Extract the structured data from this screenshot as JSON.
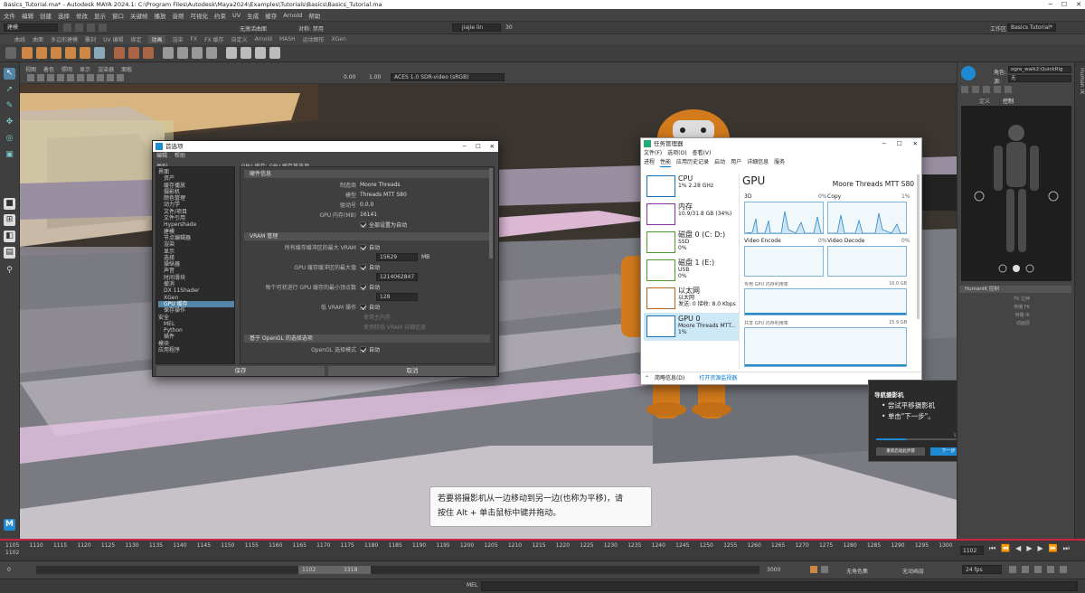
{
  "app": {
    "title": "Basics_Tutorial.ma* - Autodesk MAYA 2024.1: C:\\Program Files\\Autodesk\\Maya2024\\Examples\\Tutorials\\Basics\\Basics_Tutorial.ma",
    "menu": [
      "文件",
      "编辑",
      "创建",
      "选择",
      "修改",
      "显示",
      "窗口",
      "动画",
      "播放",
      "音频",
      "可视化",
      "缓存",
      "Arnold",
      "帮助"
    ],
    "menu_left": [
      "文件",
      "编辑",
      "创建",
      "选择",
      "修改",
      "显示",
      "窗口",
      "关键帧",
      "播放",
      "音频",
      "可视化",
      "约束",
      "UV",
      "生成",
      "缓存",
      "Arnold",
      "帮助"
    ],
    "mode": "建模",
    "no_live": "无激活曲面",
    "symmetry": "对称: 禁用",
    "user": "jiajie lin",
    "credits": "30",
    "workspace_label": "工作区:",
    "workspace": "Basics Tutorial*",
    "shelf_tabs": [
      "曲线",
      "曲面",
      "多边形建模",
      "雕刻",
      "UV 编辑",
      "绑定",
      "动画",
      "渲染",
      "FX",
      "FX 缓存",
      "自定义",
      "Arnold",
      "MASH",
      "运动图形",
      "XGen"
    ],
    "shelf_active": "动画"
  },
  "viewport": {
    "menu": [
      "视图",
      "着色",
      "照明",
      "显示",
      "渲染器",
      "面板"
    ],
    "exposure": "0.00",
    "gamma": "1.00",
    "colorspace": "ACES 1.0 SDR-video (sRGB)"
  },
  "right": {
    "char_label": "角色:",
    "char_value": "ogre_walk2:QuickRig",
    "src_label": "源:",
    "src_value": "无",
    "tabs": [
      "定义",
      "控制"
    ],
    "hik_label": "HumanIK 控制",
    "rows": [
      "FK 拉伸",
      "骨骼 FK",
      "骨骼 IK",
      "动画层"
    ],
    "side": "Human IK"
  },
  "prefs": {
    "title": "首选项",
    "menu": [
      "编辑",
      "帮助"
    ],
    "header": "GPU 缓存: GPU 缓存首选项",
    "cat_label": "类别",
    "categories": [
      "界面",
      "资产",
      "缓存播放",
      "摄影机",
      "颜色管理",
      "动力学",
      "文件/项目",
      "文件引用",
      "Hypershade",
      "建模",
      "节点编辑器",
      "渲染",
      "显示",
      "选择",
      "操纵器",
      "声音",
      "时间滑块",
      "撤消",
      "DX 11Shader",
      "XGen",
      "GPU 缓存",
      "保存操作",
      "安全",
      "MEL",
      "Python",
      "插件",
      "模块",
      "应用程序"
    ],
    "selected": "GPU 缓存",
    "hw_section": "硬件信息",
    "vendor_label": "制造商",
    "vendor": "Moore Threads",
    "model_label": "模型",
    "model": "Threads MTT S80",
    "driver_label": "驱动号",
    "driver": "0.0.0",
    "mem_label": "GPU 内存(MB)",
    "mem": "16141",
    "override": "全部设置为自动",
    "vram_section": "VRAM 管理",
    "vram1": "所有缓存缓冲区的最大 VRAM",
    "auto": "自动",
    "vram1_val": "15629",
    "mb": "MB",
    "vram2": "GPU 缓存缓冲区的最大值",
    "vram2_val": "1214062847",
    "vram3": "每个可状进行 GPU 缓存的最小顶点数",
    "vram3_val": "128",
    "low_vram": "低 VRAM 操作",
    "sub1": "使用主内存",
    "sub2": "使用较低 VRAM 详细信息",
    "opengl_section": "基于 OpenGL 的选择选项",
    "opengl_label": "OpenGL 选择模式",
    "save": "保存",
    "cancel": "取消"
  },
  "taskmgr": {
    "title": "任务管理器",
    "menu": [
      "文件(F)",
      "选项(O)",
      "查看(V)"
    ],
    "tabs": [
      "进程",
      "性能",
      "应用历史记录",
      "启动",
      "用户",
      "详细信息",
      "服务"
    ],
    "active_tab": "性能",
    "items": [
      {
        "name": "CPU",
        "l1": "1%  2.28 GHz",
        "l2": "",
        "color": "#1a73b8"
      },
      {
        "name": "内存",
        "l1": "10.9/31.8 GB (34%)",
        "l2": "",
        "color": "#8b2fa8"
      },
      {
        "name": "磁盘 0 (C: D:)",
        "l1": "SSD",
        "l2": "0%",
        "color": "#4b9b2e"
      },
      {
        "name": "磁盘 1 (E:)",
        "l1": "USB",
        "l2": "0%",
        "color": "#4b9b2e"
      },
      {
        "name": "以太网",
        "l1": "以太网",
        "l2": "发送: 0 接收: 8.0 Kbps",
        "color": "#b5651d"
      },
      {
        "name": "GPU 0",
        "l1": "Moore Threads MTT...",
        "l2": "1%",
        "color": "#1a73b8"
      }
    ],
    "gpu_title": "GPU",
    "gpu_name": "Moore Threads MTT S80",
    "g3d": "3D",
    "g3d_pct": "0%",
    "gcopy": "Copy",
    "gcopy_pct": "1%",
    "genc": "Video Encode",
    "genc_pct": "0%",
    "gdec": "Video Decode",
    "gdec_pct": "0%",
    "ded_label": "专用 GPU 内存利用率",
    "ded_val": "16.0 GB",
    "shared_label": "共享 GPU 内存利用率",
    "shared_val": "15.9 GB",
    "less": "简略信息(D)",
    "open": "打开资源监视器"
  },
  "nav": {
    "title": "导航摄影机",
    "step1": "尝试平移摄影机",
    "step2": "单击\"下一步\"。",
    "progress": "5 of 15",
    "progress_fraction": 0.33,
    "back": "重新启动此步骤",
    "next": "下一步"
  },
  "tip": {
    "line1": "若要将摄影机从一边移动到另一边(也称为平移)，请",
    "line2": "按住 Alt + 单击鼠标中键并拖动。"
  },
  "timeline": {
    "start": "1102",
    "ticks": [
      "1105",
      "1110",
      "1115",
      "1120",
      "1125",
      "1130",
      "1135",
      "1140",
      "1145",
      "1150",
      "1155",
      "1160",
      "1165",
      "1170",
      "1175",
      "1180",
      "1185",
      "1190",
      "1195",
      "1200",
      "1205",
      "1210",
      "1215",
      "1220",
      "1225",
      "1230",
      "1235",
      "1240",
      "1245",
      "1250",
      "1255",
      "1260",
      "1265",
      "1270",
      "1275",
      "1280",
      "1285",
      "1290",
      "1295",
      "1300"
    ],
    "current": "1102",
    "range_start": "0",
    "range_a": "1102",
    "range_b": "3318",
    "range_end": "3000",
    "no_char": "无角色集",
    "no_layer": "无动画层",
    "fps": "24 fps"
  },
  "cmd": {
    "label": "MEL"
  }
}
